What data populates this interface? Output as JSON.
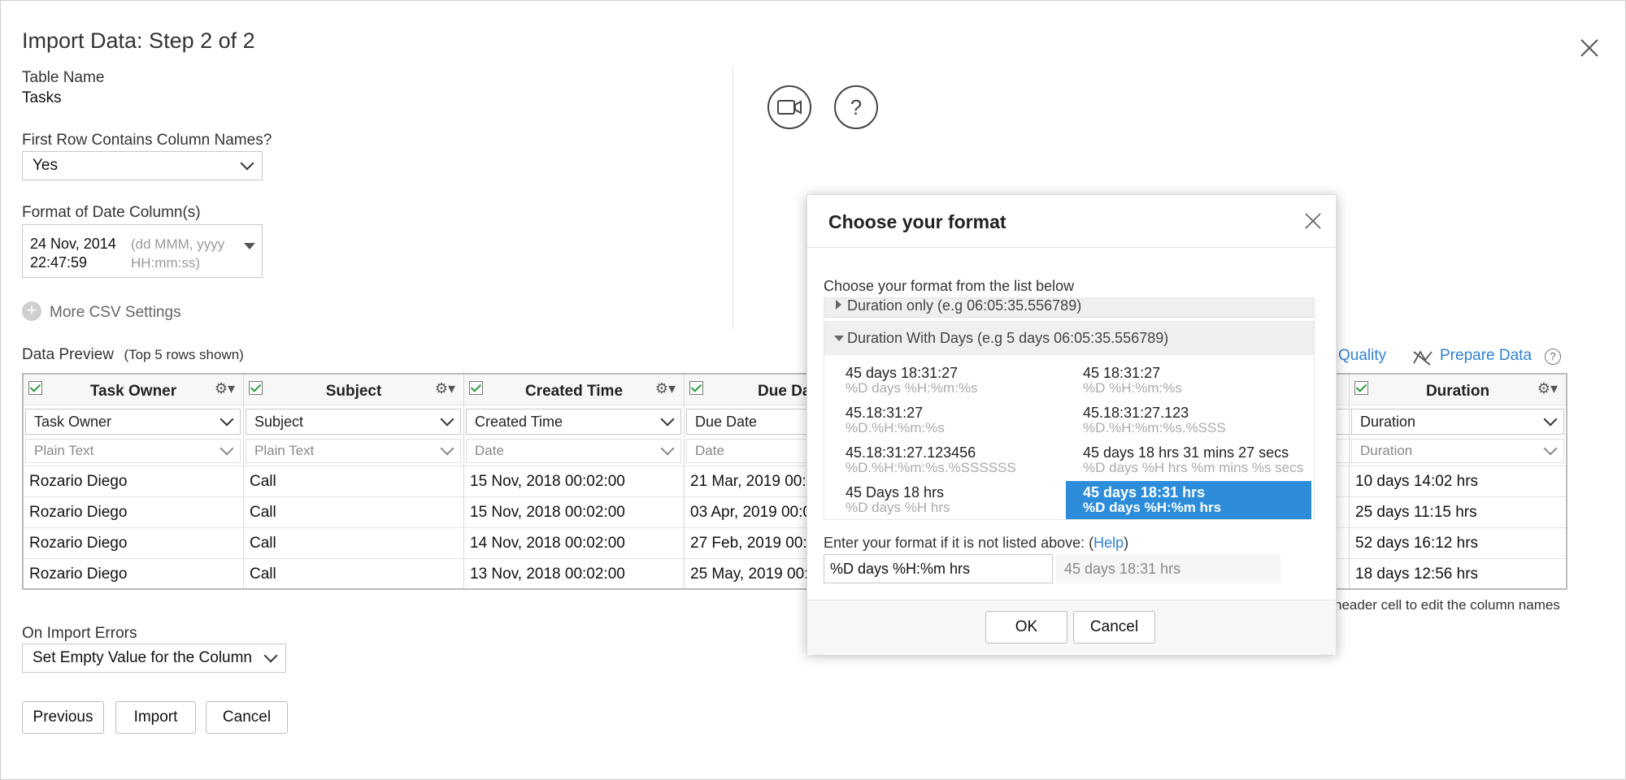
{
  "dialog": {
    "title": "Import Data: Step 2 of 2"
  },
  "table_name": {
    "label": "Table Name",
    "value": "Tasks"
  },
  "first_row": {
    "label": "First Row Contains Column Names?",
    "value": "Yes"
  },
  "date_format": {
    "label": "Format of Date Column(s)",
    "value": "24 Nov, 2014 22:47:59",
    "hint": "(dd MMM, yyyy HH:mm:ss)"
  },
  "more_csv": {
    "label": "More CSV Settings"
  },
  "preview": {
    "label": "Data Preview",
    "note": "(Top 5 rows shown)"
  },
  "links": {
    "quality": "Quality",
    "prepare": "Prepare Data"
  },
  "help_symbol": "?",
  "gear_symbol": "⚙▾",
  "columns": [
    {
      "name": "Task Owner",
      "select": "Task Owner",
      "type": "Plain Text",
      "cells": [
        "Rozario Diego",
        "Rozario Diego",
        "Rozario Diego",
        "Rozario Diego"
      ]
    },
    {
      "name": "Subject",
      "select": "Subject",
      "type": "Plain Text",
      "cells": [
        "Call",
        "Call",
        "Call",
        "Call"
      ]
    },
    {
      "name": "Created Time",
      "select": "Created Time",
      "type": "Date",
      "cells": [
        "15 Nov, 2018 00:02:00",
        "15 Nov, 2018 00:02:00",
        "14 Nov, 2018 00:02:00",
        "13 Nov, 2018 00:02:00"
      ]
    },
    {
      "name": "Due Da",
      "select": "Due Date",
      "type": "Date",
      "cells": [
        "21 Mar, 2019 00:0",
        "03 Apr, 2019 00:0",
        "27 Feb, 2019 00:0",
        "25 May, 2019 00:0"
      ]
    },
    {
      "name": "Duration",
      "select": "Duration",
      "type": "Duration",
      "cells": [
        "10 days 14:02 hrs",
        "25 days 11:15 hrs",
        "52 days 16:12 hrs",
        "18 days 12:56 hrs"
      ]
    }
  ],
  "table_hint": "header cell to edit the column names",
  "import_errors": {
    "label": "On Import Errors",
    "value": "Set Empty Value for the Column"
  },
  "buttons": {
    "previous": "Previous",
    "import": "Import",
    "cancel": "Cancel"
  },
  "modal": {
    "title": "Choose your format",
    "list_label": "Choose your format from the list below",
    "group_collapsed": "Duration only (e.g 06:05:35.556789)",
    "group_expanded": "Duration With Days (e.g 5 days 06:05:35.556789)",
    "options": [
      {
        "example": "45 days 18:31:27",
        "pattern": "%D days %H:%m:%s"
      },
      {
        "example": "45 18:31:27",
        "pattern": "%D %H:%m:%s"
      },
      {
        "example": "45.18:31:27",
        "pattern": "%D.%H:%m:%s"
      },
      {
        "example": "45.18:31:27.123",
        "pattern": "%D.%H:%m:%s.%SSS"
      },
      {
        "example": "45.18:31:27.123456",
        "pattern": "%D.%H:%m:%s.%SSSSSS"
      },
      {
        "example": "45 days 18 hrs 31 mins 27 secs",
        "pattern": "%D days %H hrs %m mins %s secs"
      },
      {
        "example": "45 Days 18 hrs",
        "pattern": "%D days %H hrs"
      },
      {
        "example": "45 days 18:31 hrs",
        "pattern": "%D days %H:%m hrs"
      }
    ],
    "custom_label_pre": "Enter your format if it is not listed above: (",
    "custom_label_link": "Help",
    "custom_label_post": ")",
    "custom_value": "%D days %H:%m hrs",
    "custom_preview": "45 days 18:31 hrs",
    "ok": "OK",
    "cancel": "Cancel"
  }
}
